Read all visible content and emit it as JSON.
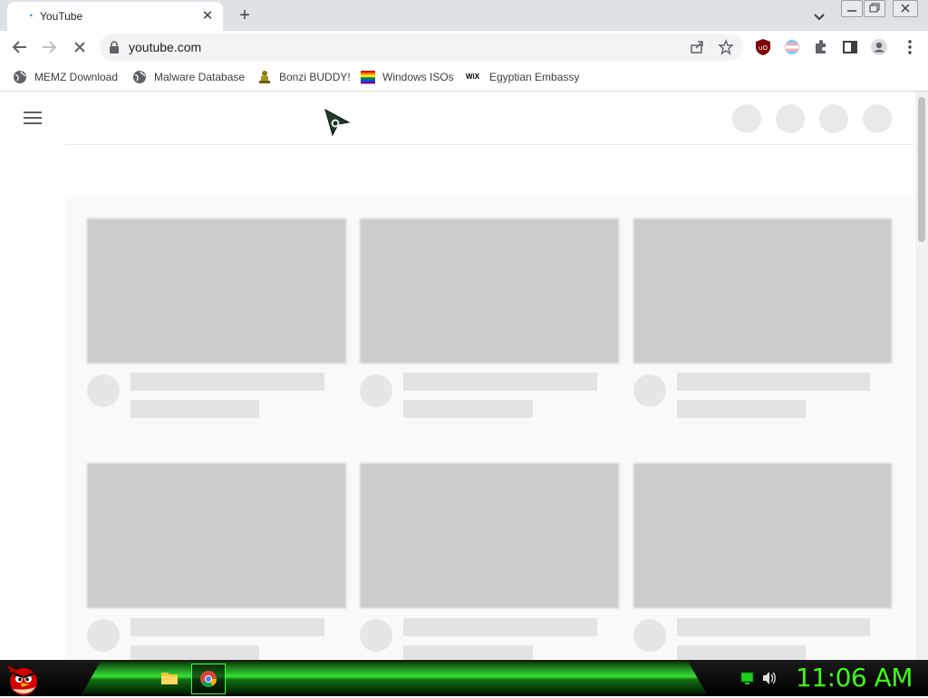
{
  "tab": {
    "title": "YouTube",
    "close": "✕"
  },
  "new_tab": "+",
  "toolbar": {
    "url": "youtube.com"
  },
  "bookmarks": [
    {
      "label": "MEMZ Download",
      "icon": "globe-icon"
    },
    {
      "label": "Malware Database",
      "icon": "globe-icon"
    },
    {
      "label": "Bonzi BUDDY!",
      "icon": "bonzi-icon"
    },
    {
      "label": "Windows ISOs",
      "icon": "rainbow-flag-icon"
    },
    {
      "label": "Egyptian Embassy",
      "icon": "wix-icon"
    }
  ],
  "wix_glyph": "WiX",
  "taskbar": {
    "clock": "11:06 AM"
  },
  "colors": {
    "clock": "#39ff14",
    "tab_strip": "#dee1e6",
    "placeholder": "#cccccc"
  }
}
